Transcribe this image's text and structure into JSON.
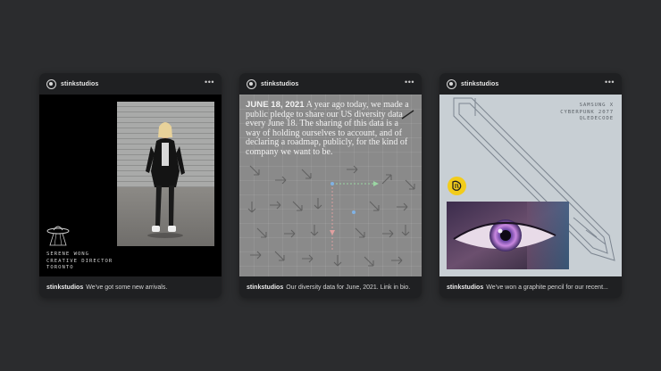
{
  "posts": [
    {
      "username": "stinkstudios",
      "caption": "We've got some new arrivals.",
      "image_text": [
        "SERENE WONG",
        "CREATIVE DIRECTOR",
        "TORONTO"
      ]
    },
    {
      "username": "stinkstudios",
      "caption": "Our diversity data for June, 2021. Link in bio.",
      "image_date": "JUNE 18, 2021",
      "image_quote": "A year ago today, we made a public pledge to share our US diversity data every June 18. The sharing of this data is a way of holding ourselves to account, and of declaring a roadmap, publicly, for the kind of company we want to be."
    },
    {
      "username": "stinkstudios",
      "caption": "We've won a graphite pencil for our recent...",
      "image_text": [
        "SAMSUNG X",
        "CYBERPUNK 2077",
        "QLEDECODE"
      ]
    }
  ],
  "more_glyph": "•••",
  "colors": {
    "background": "#2b2c2e",
    "card": "#1f2022",
    "badge_yellow": "#f2cc1b"
  }
}
